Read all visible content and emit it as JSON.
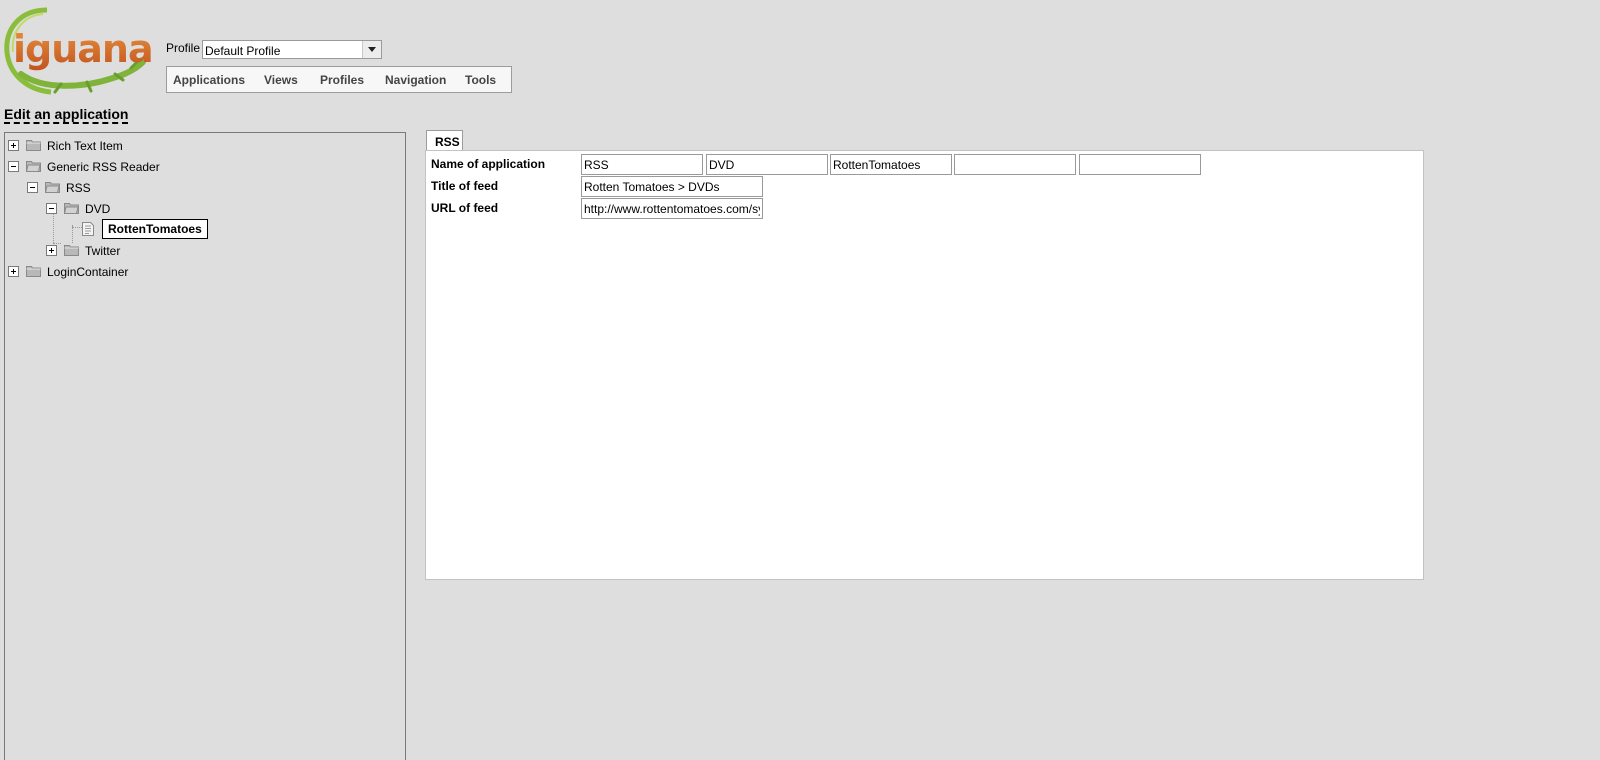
{
  "logo": {
    "text": "iguana"
  },
  "profile": {
    "label": "Profile",
    "selected": "Default Profile"
  },
  "menu": [
    "Applications",
    "Views",
    "Profiles",
    "Navigation",
    "Tools"
  ],
  "page_title": "Edit an application",
  "tree": {
    "items": [
      {
        "label": "Rich Text Item",
        "expanded": false
      },
      {
        "label": "Generic RSS Reader",
        "expanded": true
      },
      {
        "label": "RSS",
        "expanded": true
      },
      {
        "label": "DVD",
        "expanded": true
      },
      {
        "label": "RottenTomatoes",
        "selected": true,
        "icon": "document-icon"
      },
      {
        "label": "Twitter",
        "expanded": false
      },
      {
        "label": "LoginContainer",
        "expanded": false
      }
    ]
  },
  "editor": {
    "tab": "RSS",
    "fields": {
      "name": {
        "label": "Name of application",
        "values": [
          "RSS",
          "DVD",
          "RottenTomatoes",
          "",
          ""
        ]
      },
      "title": {
        "label": "Title of feed",
        "value": "Rotten Tomatoes > DVDs"
      },
      "url": {
        "label": "URL of feed",
        "value": "http://www.rottentomatoes.com/syndication/rss/"
      }
    }
  },
  "colors": {
    "background": "#dedede",
    "logo_orange": "#d9712e",
    "logo_green": "#7fb33a"
  }
}
